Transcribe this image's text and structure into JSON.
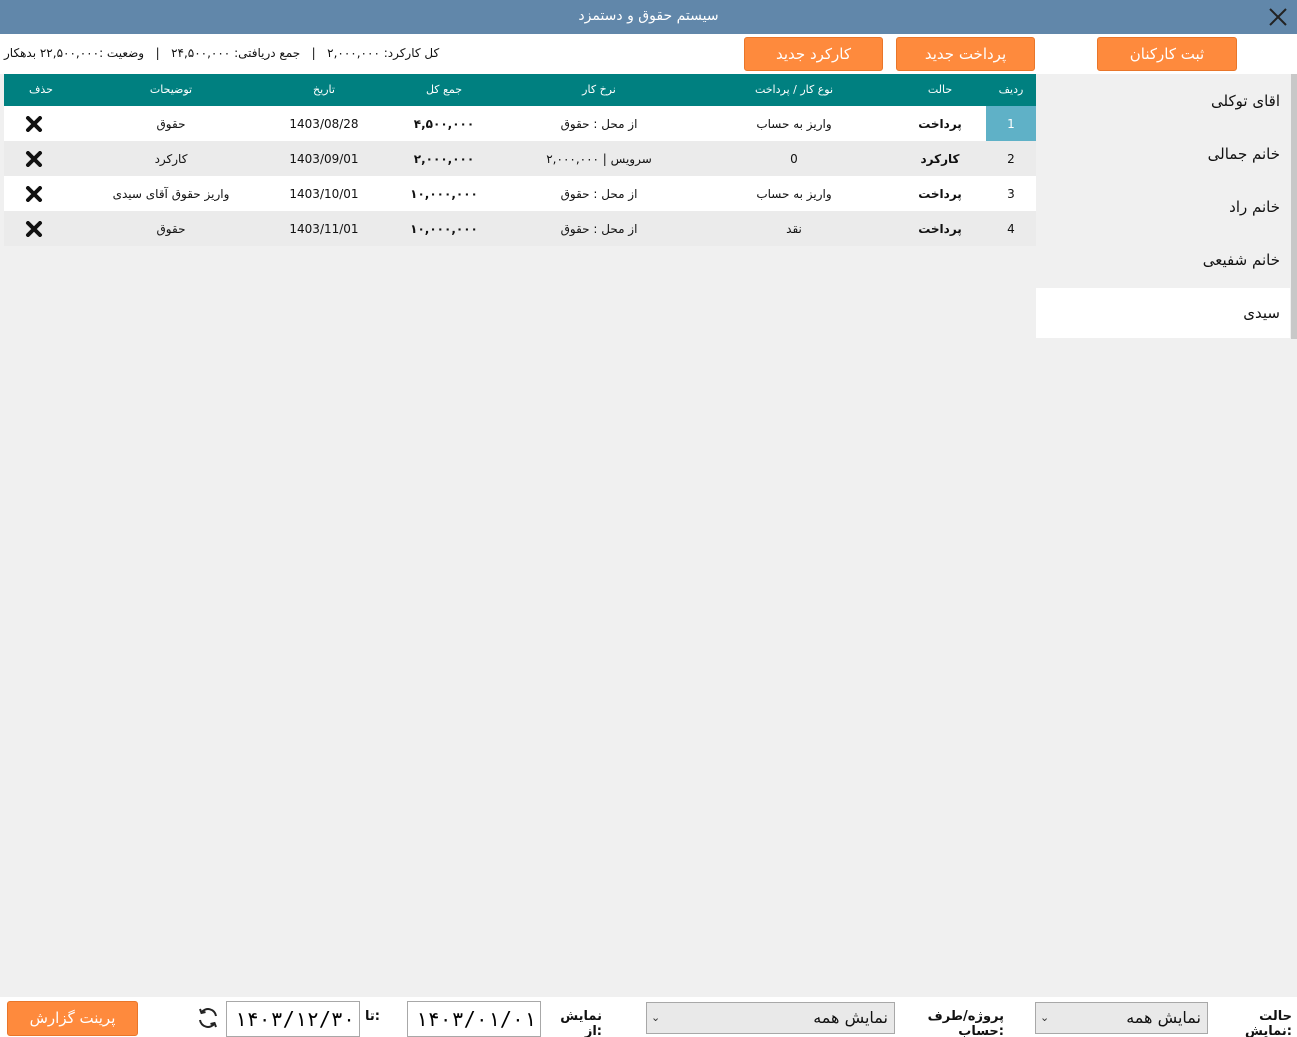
{
  "window": {
    "title": "سیستم حقوق و دستمزد"
  },
  "summary": {
    "total_work": "کل کارکرد: ۲,۰۰۰,۰۰۰",
    "total_received": "جمع دریافتی: ۲۴,۵۰۰,۰۰۰",
    "status": "وضعیت :۲۲,۵۰۰,۰۰۰ بدهکار",
    "sep": "|"
  },
  "buttons": {
    "register_staff": "ثبت کارکنان",
    "new_payment": "پرداخت جدید",
    "new_work": "کارکرد جدید",
    "print_report": "پرینت گزارش"
  },
  "employees": [
    {
      "name": "اقای توکلی"
    },
    {
      "name": "خانم جمالی"
    },
    {
      "name": "خانم راد"
    },
    {
      "name": "خانم شفیعی"
    },
    {
      "name": "سیدی"
    }
  ],
  "table": {
    "headers": {
      "row": "ردیف",
      "status": "حالت",
      "type": "نوع کار / پرداخت",
      "rate": "نرخ کار",
      "total": "جمع کل",
      "date": "تاریخ",
      "notes": "توضیحات",
      "delete": "حذف"
    },
    "rows": [
      {
        "row": "1",
        "status": "پرداخت",
        "type": "واریز به حساب",
        "rate": "از محل : حقوق",
        "total": "۴,۵۰۰,۰۰۰",
        "date": "1403/08/28",
        "notes": "حقوق"
      },
      {
        "row": "2",
        "status": "کارکرد",
        "type": "0",
        "rate": "سرویس | ۲,۰۰۰,۰۰۰",
        "total": "۲,۰۰۰,۰۰۰",
        "date": "1403/09/01",
        "notes": "کارکرد"
      },
      {
        "row": "3",
        "status": "پرداخت",
        "type": "واریز به حساب",
        "rate": "از محل : حقوق",
        "total": "۱۰,۰۰۰,۰۰۰",
        "date": "1403/10/01",
        "notes": "واریز حقوق آقای سیدی"
      },
      {
        "row": "4",
        "status": "پرداخت",
        "type": "نقد",
        "rate": "از محل : حقوق",
        "total": "۱۰,۰۰۰,۰۰۰",
        "date": "1403/11/01",
        "notes": "حقوق"
      }
    ]
  },
  "filters": {
    "view_mode_label": "حالت نمایش:",
    "view_mode_value": "نمایش همه",
    "project_label": "پروژه/طرف حساب:",
    "project_value": "نمایش همه",
    "from_label": "نمایش از:",
    "from_value": "۱۴۰۳/۰۱/۰۱",
    "to_label": "تا:",
    "to_value": "۱۴۰۳/۱۲/۳۰"
  },
  "colors": {
    "titlebar": "#6187aa",
    "header": "#008080",
    "accent_button": "#fe8a3d",
    "selected_cell": "#5fb1c7"
  }
}
